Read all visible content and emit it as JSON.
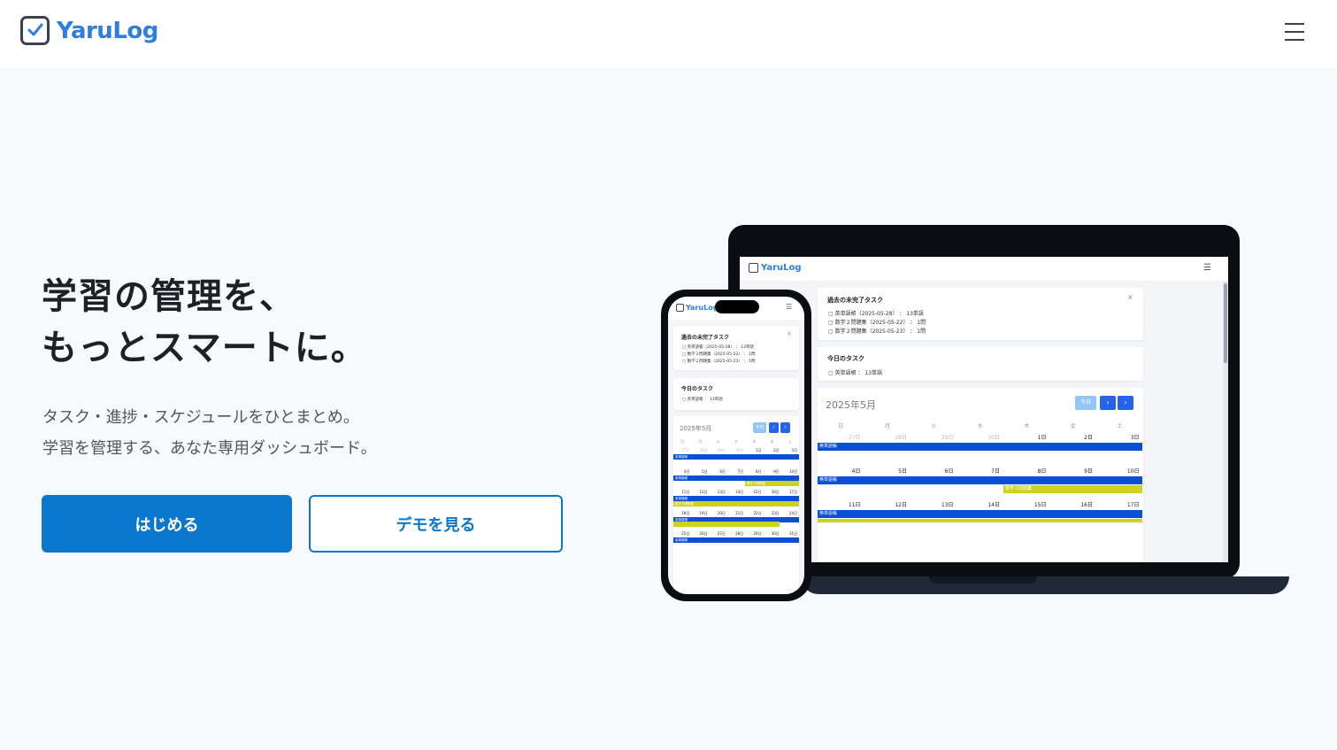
{
  "header": {
    "logo_text": "YaruLog",
    "logo_icon": "check-square-icon",
    "menu_icon": "hamburger-menu-icon"
  },
  "hero": {
    "title_line1": "学習の管理を、",
    "title_line2": "もっとスマートに。",
    "sub_line1": "タスク・進捗・スケジュールをひとまとめ。",
    "sub_line2": "学習を管理する、あなた専用ダッシュボード。",
    "primary_button": "はじめる",
    "secondary_button": "デモを見る"
  },
  "colors": {
    "accent": "#0a77cc",
    "logo": "#2f7de1",
    "event_blue": "#0b4fd6",
    "event_yellow": "#cbd31f"
  },
  "mockup": {
    "logo_text": "YaruLog",
    "menu_glyph": "☰",
    "close_glyph": "×",
    "past_tasks": {
      "title": "過去の未完了タスク",
      "items": [
        "▢ 英単語帳（2025-05-28） ： 13単語",
        "▢ 数学２問題集（2025-05-22） ： 1問",
        "▢ 数学２問題集（2025-05-23） ： 1問"
      ]
    },
    "today_tasks": {
      "title": "今日のタスク",
      "items": [
        "▢ 英単語帳 ： 13単語"
      ]
    },
    "calendar": {
      "title": "2025年5月",
      "today_button": "今日",
      "prev": "‹",
      "next": "›",
      "weekdays": [
        "日",
        "月",
        "火",
        "水",
        "木",
        "金",
        "土"
      ],
      "weeks": [
        [
          "27日",
          "28日",
          "29日",
          "30日",
          "1日",
          "2日",
          "3日"
        ],
        [
          "4日",
          "5日",
          "6日",
          "7日",
          "8日",
          "9日",
          "10日"
        ],
        [
          "11日",
          "12日",
          "13日",
          "14日",
          "15日",
          "16日",
          "17日"
        ]
      ],
      "phone_weeks": [
        [
          "27日",
          "28日",
          "29日",
          "30日",
          "1日",
          "2日",
          "3日"
        ],
        [
          "4日",
          "5日",
          "6日",
          "7日",
          "8日",
          "9日",
          "10日"
        ],
        [
          "11日",
          "12日",
          "13日",
          "14日",
          "15日",
          "16日",
          "17日"
        ],
        [
          "18日",
          "19日",
          "20日",
          "21日",
          "22日",
          "23日",
          "24日"
        ],
        [
          "25日",
          "26日",
          "27日",
          "28日",
          "29日",
          "30日",
          "31日"
        ]
      ],
      "event_english": "英単語帳",
      "event_math": "数学２問題集"
    }
  }
}
